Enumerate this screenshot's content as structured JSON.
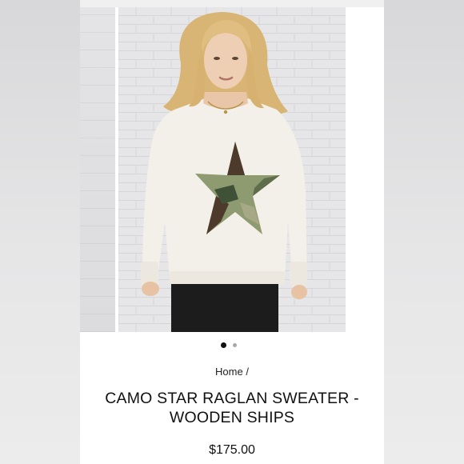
{
  "breadcrumb": {
    "home_label": "Home",
    "separator": "/"
  },
  "product": {
    "title_line1": "CAMO STAR RAGLAN SWEATER -",
    "title_line2": "WOODEN SHIPS",
    "price": "$175.00"
  },
  "gallery": {
    "total_slides": 2,
    "active_slide": 1
  },
  "icons": {
    "zoom": "magnifier-icon"
  },
  "colors": {
    "sweater": "#f4f1ea",
    "star_green": "#8f9a72",
    "star_brown": "#4e3b2c",
    "pants": "#1c1c1c",
    "wall": "#e5e5e7",
    "hair": "#d9b77a"
  }
}
